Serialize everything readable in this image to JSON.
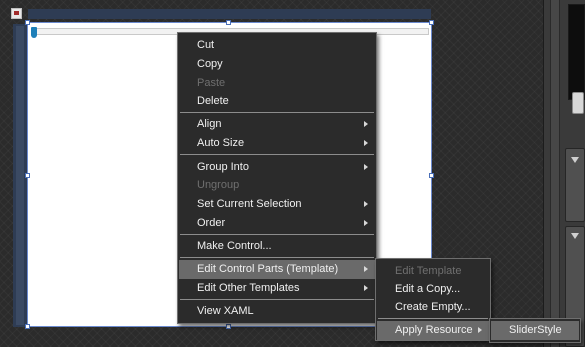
{
  "context_menu": {
    "items": [
      {
        "label": "Cut",
        "enabled": true
      },
      {
        "label": "Copy",
        "enabled": true
      },
      {
        "label": "Paste",
        "enabled": false
      },
      {
        "label": "Delete",
        "enabled": true
      },
      {
        "label": "Align",
        "enabled": true,
        "submenu": true
      },
      {
        "label": "Auto Size",
        "enabled": true,
        "submenu": true
      },
      {
        "label": "Group Into",
        "enabled": true,
        "submenu": true
      },
      {
        "label": "Ungroup",
        "enabled": false
      },
      {
        "label": "Set Current Selection",
        "enabled": true,
        "submenu": true
      },
      {
        "label": "Order",
        "enabled": true,
        "submenu": true
      },
      {
        "label": "Make Control...",
        "enabled": true
      },
      {
        "label": "Edit Control Parts (Template)",
        "enabled": true,
        "submenu": true,
        "highlighted": true
      },
      {
        "label": "Edit Other Templates",
        "enabled": true,
        "submenu": true
      },
      {
        "label": "View XAML",
        "enabled": true
      }
    ]
  },
  "template_submenu": {
    "items": [
      {
        "label": "Edit Template",
        "enabled": false
      },
      {
        "label": "Edit a Copy...",
        "enabled": true
      },
      {
        "label": "Create Empty...",
        "enabled": true
      },
      {
        "label": "Apply Resource",
        "enabled": true,
        "submenu": true,
        "highlighted": true
      }
    ]
  },
  "resource_submenu": {
    "items": [
      {
        "label": "SliderStyle",
        "enabled": true,
        "highlighted": true
      }
    ]
  },
  "icons": {
    "artboard": "artboard-toggle-icon",
    "submenu_arrow": "chevron-right-icon",
    "panel_collapse": "triangle-down-icon"
  },
  "colors": {
    "menu_background": "#2b2b2b",
    "menu_highlight": "#6a6a6a",
    "menu_text": "#f0f0f0",
    "menu_disabled_text": "#6f6f6f",
    "selection_handle": "#4a6fb8",
    "slider_thumb": "#1e7fb8",
    "artboard": "#ffffff"
  }
}
